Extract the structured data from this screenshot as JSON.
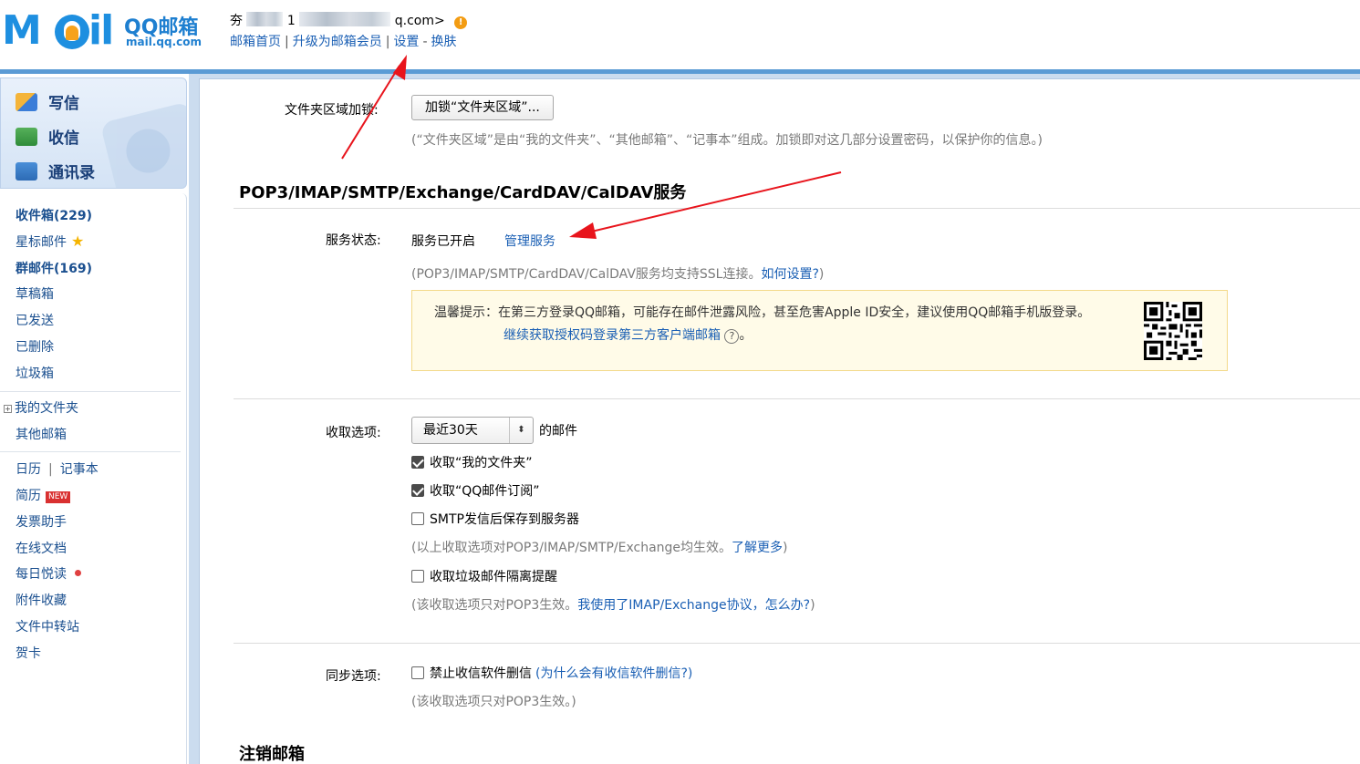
{
  "header": {
    "logo_text": "M🔔il",
    "logo_brand": "QQ邮箱",
    "logo_url": "mail.qq.com",
    "account_prefix": "夯",
    "account_start": "1",
    "account_suffix": "q.com>",
    "warning_glyph": "!",
    "links": [
      "邮箱首页",
      "升级为邮箱会员",
      "设置",
      "换肤"
    ],
    "link_separators": [
      "|",
      "|",
      "-"
    ]
  },
  "sidebar": {
    "quick": [
      {
        "label": "写信",
        "icon": "compose-icon"
      },
      {
        "label": "收信",
        "icon": "inbox-download-icon"
      },
      {
        "label": "通讯录",
        "icon": "contacts-icon"
      }
    ],
    "folders": [
      {
        "label": "收件箱(229)",
        "bold": true
      },
      {
        "label": "星标邮件",
        "star": "★"
      },
      {
        "label": "群邮件(169)",
        "bold": true
      },
      {
        "label": "草稿箱"
      },
      {
        "label": "已发送"
      },
      {
        "label": "已删除"
      },
      {
        "label": "垃圾箱"
      }
    ],
    "my_folders": "我的文件夹",
    "my_folders_toggle": "+",
    "other_mail": "其他邮箱",
    "calendar": "日历",
    "calendar_sep": "|",
    "notebook": "记事本",
    "resume": "简历",
    "resume_badge": "NEW",
    "tools": [
      "发票助手",
      "在线文档",
      "每日悦读",
      "附件收藏",
      "文件中转站",
      "贺卡"
    ]
  },
  "settings": {
    "folder_lock_label": "文件夹区域加锁:",
    "folder_lock_button": "加锁“文件夹区域”...",
    "folder_lock_hint": "(“文件夹区域”是由“我的文件夹”、“其他邮箱”、“记事本”组成。加锁即对这几部分设置密码，以保护你的信息。)",
    "pop_section_title": "POP3/IMAP/SMTP/Exchange/CardDAV/CalDAV服务",
    "service_status_label": "服务状态:",
    "service_status_value": "服务已开启",
    "manage_service": "管理服务",
    "ssl_hint_prefix": "(POP3/IMAP/SMTP/CardDAV/CalDAV服务均支持SSL连接。",
    "ssl_hint_link": "如何设置?",
    "ssl_hint_suffix": ")",
    "tip_text": "温馨提示：在第三方登录QQ邮箱，可能存在邮件泄露风险，甚至危害Apple ID安全，建议使用QQ邮箱手机版登录。",
    "tip_link": "继续获取授权码登录第三方客户端邮箱",
    "tip_help_glyph": "?",
    "tip_end": "。",
    "receive_label": "收取选项:",
    "receive_select_value": "最近30天",
    "receive_select_arrow": "⬍",
    "receive_suffix": "的邮件",
    "cb_my_folders": "收取“我的文件夹”",
    "cb_subscription": "收取“QQ邮件订阅”",
    "cb_smtp_save": "SMTP发信后保存到服务器",
    "receive_hint_prefix": "(以上收取选项对POP3/IMAP/SMTP/Exchange均生效。",
    "receive_hint_link": "了解更多",
    "receive_hint_suffix": ")",
    "cb_spam_reminder": "收取垃圾邮件隔离提醒",
    "pop3_hint_prefix": "(该收取选项只对POP3生效。",
    "pop3_hint_link": "我使用了IMAP/Exchange协议，怎么办?",
    "pop3_hint_suffix": ")",
    "sync_label": "同步选项:",
    "cb_no_delete": "禁止收信软件删信",
    "sync_why": "(为什么会有收信软件删信?)",
    "sync_hint": "(该收取选项只对POP3生效。)",
    "cancel_section_title": "注销邮箱"
  },
  "colors": {
    "link": "#1a5fb4",
    "brand_blue": "#1e8fe0",
    "annotation_arrow": "#e8141c",
    "tip_background": "#fffbe8"
  }
}
